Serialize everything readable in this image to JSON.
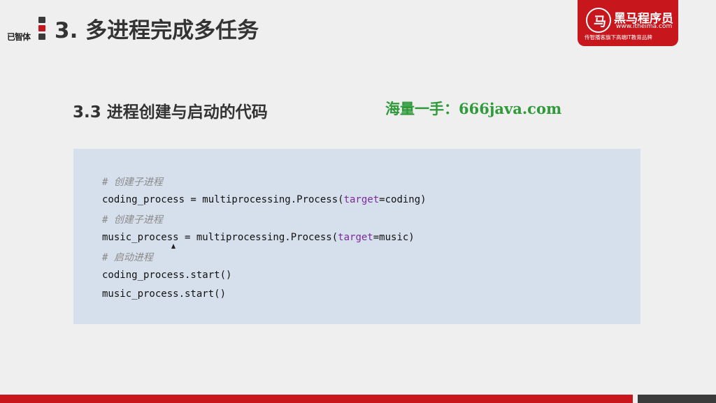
{
  "header": {
    "mark": "已智体",
    "section_title": "3. 多进程完成多任务"
  },
  "logo": {
    "glyph": "马",
    "name": "黑马程序员",
    "url": "www.itheima.com",
    "tagline": "传智播客旗下高端IT教育品牌"
  },
  "slide": {
    "subtitle": "3.3 进程创建与启动的代码",
    "watermark": "海量一手：666java.com"
  },
  "code": {
    "comment1": "# 创建子进程",
    "line1_pre": "coding_process = multiprocessing.Process(",
    "line1_kw": "target",
    "line1_post": "=coding)",
    "comment2": "# 创建子进程",
    "line2_pre": "music_process = multiprocessing.Process(",
    "line2_kw": "target",
    "line2_post": "=music)",
    "comment3": "# 启动进程",
    "line3": "coding_process.start()",
    "line4": "music_process.start()"
  },
  "colors": {
    "brand_red": "#c8161d",
    "code_bg": "#d6e0ec",
    "keyword": "#7a2a9a",
    "watermark": "#2e9a3a"
  }
}
